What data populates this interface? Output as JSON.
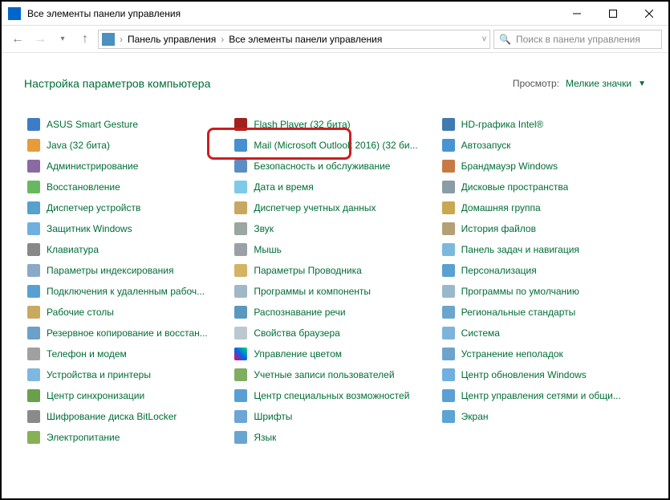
{
  "window": {
    "title": "Все элементы панели управления"
  },
  "breadcrumb": {
    "seg1": "Панель управления",
    "seg2": "Все элементы панели управления"
  },
  "search": {
    "placeholder": "Поиск в панели управления"
  },
  "page": {
    "heading": "Настройка параметров компьютера"
  },
  "view": {
    "label": "Просмотр:",
    "value": "Мелкие значки"
  },
  "items": {
    "c0": [
      {
        "label": "ASUS Smart Gesture",
        "icon": "icon-asus"
      },
      {
        "label": "Java (32 бита)",
        "icon": "icon-java"
      },
      {
        "label": "Администрирование",
        "icon": "icon-admin"
      },
      {
        "label": "Восстановление",
        "icon": "icon-recovery"
      },
      {
        "label": "Диспетчер устройств",
        "icon": "icon-devmgr"
      },
      {
        "label": "Защитник Windows",
        "icon": "icon-defender"
      },
      {
        "label": "Клавиатура",
        "icon": "icon-keyboard"
      },
      {
        "label": "Параметры индексирования",
        "icon": "icon-indexing"
      },
      {
        "label": "Подключения к удаленным рабоч...",
        "icon": "icon-rdp"
      },
      {
        "label": "Рабочие столы",
        "icon": "icon-desktops"
      },
      {
        "label": "Резервное копирование и восстан...",
        "icon": "icon-backup"
      },
      {
        "label": "Телефон и модем",
        "icon": "icon-phone"
      },
      {
        "label": "Устройства и принтеры",
        "icon": "icon-printers"
      },
      {
        "label": "Центр синхронизации",
        "icon": "icon-sync"
      },
      {
        "label": "Шифрование диска BitLocker",
        "icon": "icon-bitlocker"
      },
      {
        "label": "Электропитание",
        "icon": "icon-power"
      }
    ],
    "c1": [
      {
        "label": "Flash Player (32 бита)",
        "icon": "icon-flash"
      },
      {
        "label": "Mail (Microsoft Outlook 2016) (32 би...",
        "icon": "icon-mail"
      },
      {
        "label": "Безопасность и обслуживание",
        "icon": "icon-security"
      },
      {
        "label": "Дата и время",
        "icon": "icon-date"
      },
      {
        "label": "Диспетчер учетных данных",
        "icon": "icon-creds"
      },
      {
        "label": "Звук",
        "icon": "icon-sound"
      },
      {
        "label": "Мышь",
        "icon": "icon-mouse"
      },
      {
        "label": "Параметры Проводника",
        "icon": "icon-explorer"
      },
      {
        "label": "Программы и компоненты",
        "icon": "icon-programs"
      },
      {
        "label": "Распознавание речи",
        "icon": "icon-speech"
      },
      {
        "label": "Свойства браузера",
        "icon": "icon-browser"
      },
      {
        "label": "Управление цветом",
        "icon": "icon-color"
      },
      {
        "label": "Учетные записи пользователей",
        "icon": "icon-accounts"
      },
      {
        "label": "Центр специальных возможностей",
        "icon": "icon-access"
      },
      {
        "label": "Шрифты",
        "icon": "icon-fonts"
      },
      {
        "label": "Язык",
        "icon": "icon-lang"
      }
    ],
    "c2": [
      {
        "label": "HD-графика Intel®",
        "icon": "icon-intel"
      },
      {
        "label": "Автозапуск",
        "icon": "icon-autorun"
      },
      {
        "label": "Брандмауэр Windows",
        "icon": "icon-firewall"
      },
      {
        "label": "Дисковые пространства",
        "icon": "icon-storage"
      },
      {
        "label": "Домашняя группа",
        "icon": "icon-homegroup"
      },
      {
        "label": "История файлов",
        "icon": "icon-history"
      },
      {
        "label": "Панель задач и навигация",
        "icon": "icon-taskbar"
      },
      {
        "label": "Персонализация",
        "icon": "icon-personal"
      },
      {
        "label": "Программы по умолчанию",
        "icon": "icon-defaults"
      },
      {
        "label": "Региональные стандарты",
        "icon": "icon-region"
      },
      {
        "label": "Система",
        "icon": "icon-system"
      },
      {
        "label": "Устранение неполадок",
        "icon": "icon-trouble"
      },
      {
        "label": "Центр обновления Windows",
        "icon": "icon-update"
      },
      {
        "label": "Центр управления сетями и общи...",
        "icon": "icon-network"
      },
      {
        "label": "Экран",
        "icon": "icon-display"
      }
    ]
  },
  "highlighted_item": "Flash Player (32 бита)"
}
